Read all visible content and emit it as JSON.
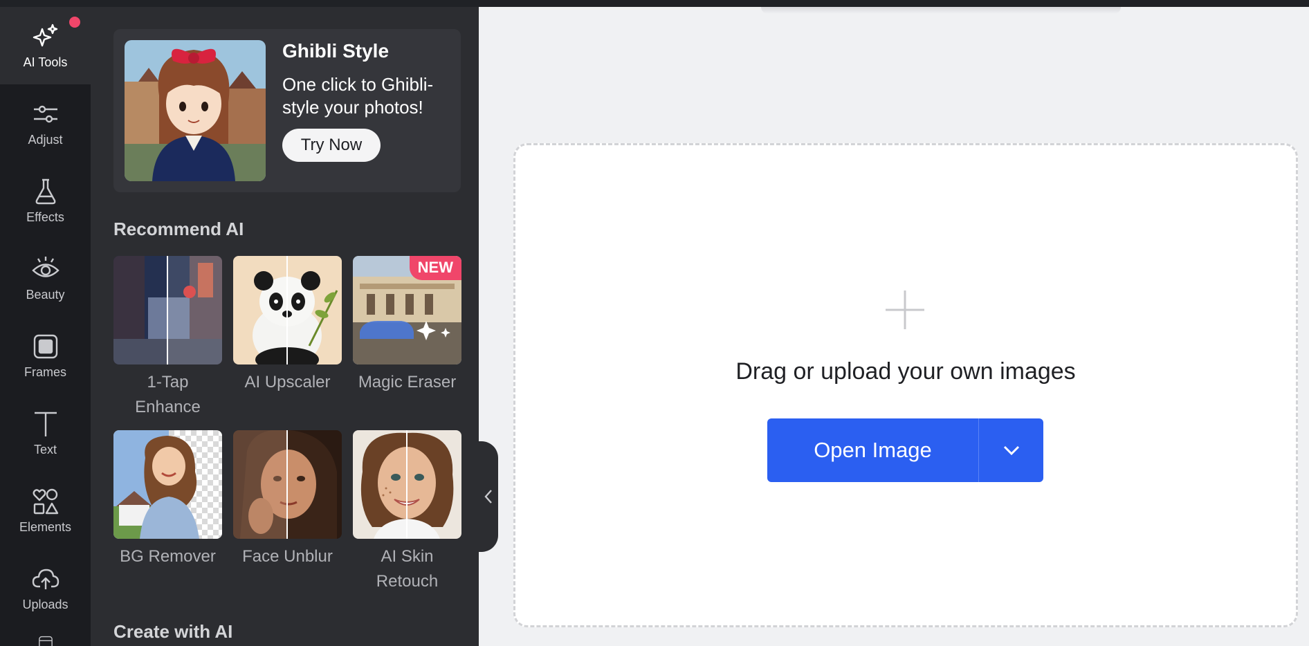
{
  "rail": {
    "items": [
      {
        "label": "AI Tools",
        "icon": "sparkle-icon",
        "active": true
      },
      {
        "label": "Adjust",
        "icon": "sliders-icon"
      },
      {
        "label": "Effects",
        "icon": "flask-icon"
      },
      {
        "label": "Beauty",
        "icon": "eye-icon"
      },
      {
        "label": "Frames",
        "icon": "frame-icon"
      },
      {
        "label": "Text",
        "icon": "text-icon"
      },
      {
        "label": "Elements",
        "icon": "shapes-icon"
      },
      {
        "label": "Uploads",
        "icon": "cloud-upload-icon"
      }
    ],
    "notification_color": "#f0466a"
  },
  "promo": {
    "title": "Ghibli Style",
    "description": "One click to Ghibli-style your photos!",
    "button": "Try Now"
  },
  "recommend": {
    "title": "Recommend AI",
    "tools": [
      {
        "label": "1-Tap Enhance"
      },
      {
        "label": "AI Upscaler"
      },
      {
        "label": "Magic Eraser",
        "badge": "NEW"
      },
      {
        "label": "BG Remover"
      },
      {
        "label": "Face Unblur"
      },
      {
        "label": "AI Skin Retouch"
      }
    ]
  },
  "create": {
    "title": "Create with AI"
  },
  "canvas": {
    "drop_text": "Drag or upload your own images",
    "open_button": "Open Image"
  },
  "colors": {
    "accent": "#2b5ff1",
    "badge": "#f0466a",
    "panel": "#2c2d31",
    "rail": "#1b1c20"
  }
}
